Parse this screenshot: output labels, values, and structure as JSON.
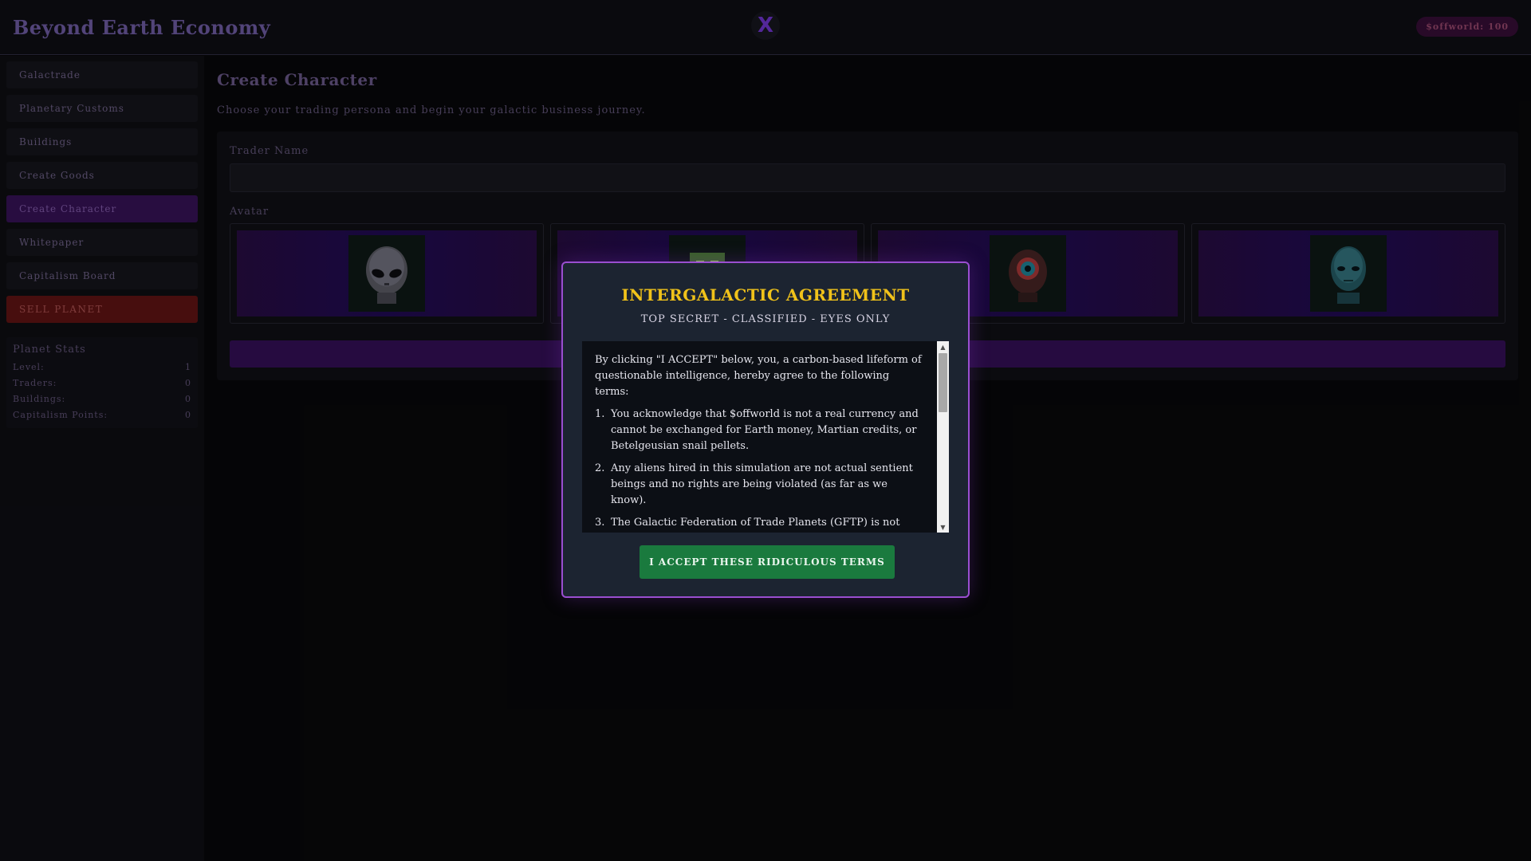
{
  "header": {
    "app_title": "Beyond Earth Economy",
    "x_icon_glyph": "X",
    "balance": "$offworld: 100"
  },
  "sidebar": {
    "items": [
      {
        "label": "Galactrade"
      },
      {
        "label": "Planetary Customs"
      },
      {
        "label": "Buildings"
      },
      {
        "label": "Create Goods"
      },
      {
        "label": "Create Character",
        "active": true
      },
      {
        "label": "Whitepaper"
      },
      {
        "label": "Capitalism Board"
      },
      {
        "label": "SELL PLANET",
        "danger": true
      }
    ],
    "stats": {
      "title": "Planet Stats",
      "rows": [
        {
          "label": "Level:",
          "value": "1"
        },
        {
          "label": "Traders:",
          "value": "0"
        },
        {
          "label": "Buildings:",
          "value": "0"
        },
        {
          "label": "Capitalism Points:",
          "value": "0"
        }
      ]
    }
  },
  "main": {
    "title": "Create Character",
    "subtitle": "Choose your trading persona and begin your galactic business journey.",
    "trader_name_label": "Trader Name",
    "trader_name_value": "",
    "avatar_label": "Avatar",
    "avatars": [
      {
        "name": "grey-alien"
      },
      {
        "name": "green-robot"
      },
      {
        "name": "cyclops-creature"
      },
      {
        "name": "blue-alien"
      }
    ]
  },
  "modal": {
    "title": "INTERGALACTIC AGREEMENT",
    "subtitle": "TOP SECRET - CLASSIFIED - EYES ONLY",
    "intro": "By clicking \"I ACCEPT\" below, you, a carbon-based lifeform of questionable intelligence, hereby agree to the following terms:",
    "terms": [
      {
        "num": "1.",
        "text": "You acknowledge that $offworld is not a real currency and cannot be exchanged for Earth money, Martian credits, or Betelgeusian snail pellets."
      },
      {
        "num": "2.",
        "text": "Any aliens hired in this simulation are not actual sentient beings and no rights are being violated (as far as we know)."
      },
      {
        "num": "3.",
        "text": "The Galactic Federation of Trade Planets (GFTP) is not responsible for any space-time anomalies, interdimensional"
      }
    ],
    "accept_label": "I ACCEPT THESE RIDICULOUS TERMS"
  },
  "colors": {
    "accent_purple": "#9a4ed0",
    "modal_title_gold": "#f0c21a",
    "accept_green": "#1a7a3e",
    "danger_red": "#4e1010"
  }
}
